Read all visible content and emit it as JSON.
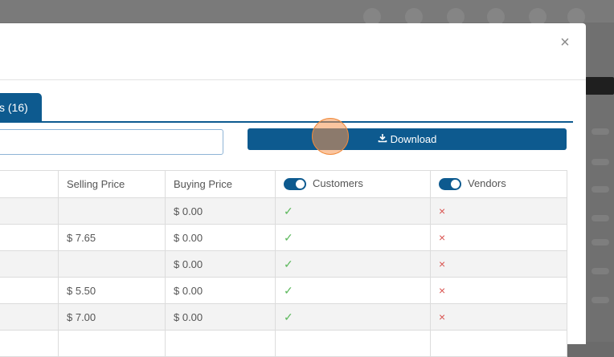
{
  "tab": {
    "label": "s (16)"
  },
  "modal": {
    "close_symbol": "×"
  },
  "toolbar": {
    "download_label": "Download",
    "download_icon": "download-icon",
    "search_placeholder": "",
    "search_value": ""
  },
  "table": {
    "headers": {
      "selling_price": "Selling Price",
      "buying_price": "Buying Price",
      "customers": "Customers",
      "vendors": "Vendors"
    },
    "toggles": {
      "customers": true,
      "vendors": true
    },
    "rows": [
      {
        "selling_price": "",
        "buying_price": "$ 0.00",
        "customers": "✓",
        "vendors": "×"
      },
      {
        "selling_price": "$ 7.65",
        "buying_price": "$ 0.00",
        "customers": "✓",
        "vendors": "×"
      },
      {
        "selling_price": "",
        "buying_price": "$ 0.00",
        "customers": "✓",
        "vendors": "×"
      },
      {
        "selling_price": "$ 5.50",
        "buying_price": "$ 0.00",
        "customers": "✓",
        "vendors": "×"
      },
      {
        "selling_price": "$ 7.00",
        "buying_price": "$ 0.00",
        "customers": "✓",
        "vendors": "×"
      },
      {
        "selling_price": "",
        "buying_price": "",
        "customers": "",
        "vendors": ""
      }
    ]
  },
  "colors": {
    "primary": "#0d5a8f",
    "check": "#5cb85c",
    "cross": "#d9534f"
  }
}
